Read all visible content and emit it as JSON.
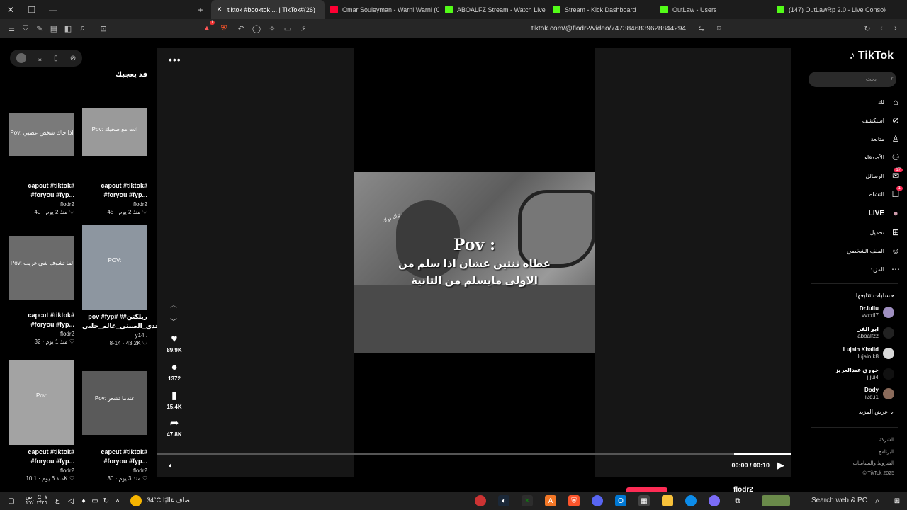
{
  "browser": {
    "tabs": [
      {
        "title": "tiktok #booktok ... | TikTok#(26)",
        "active": true,
        "favicon_color": "#ffffff"
      },
      {
        "title": "Omar Souleyman - Warni Warni (Offi",
        "active": false,
        "favicon_color": "#ff0033"
      },
      {
        "title": "ABOALFZ Stream - Watch Live on Kic",
        "active": false,
        "favicon_color": "#53fc18"
      },
      {
        "title": "Stream - Kick Dashboard",
        "active": false,
        "favicon_color": "#53fc18"
      },
      {
        "title": "OutLaw - Users",
        "active": false,
        "favicon_color": "#53fc18"
      },
      {
        "title": "(147) OutLawRp 2.0 - Live Console",
        "active": false,
        "favicon_color": "#53fc18"
      }
    ],
    "url": "tiktok.com/@flodr2/video/7473846839628844294",
    "notification_badge": "1"
  },
  "left_panel": {
    "heading": "قد يعجبك",
    "cards": [
      {
        "title": "capcut #tiktok# #foryou #fyp...",
        "user": "flodr2",
        "likes": "40",
        "age": "منذ 2 يوم",
        "pov": "Pov: اذا جاك شخص عصبي"
      },
      {
        "title": "capcut #tiktok# #foryou #fyp...",
        "user": "flodr2",
        "likes": "45",
        "age": "منذ 2 يوم",
        "pov": "Pov: انت مع صحبك"
      },
      {
        "title": "capcut #tiktok# #foryou #fyp...",
        "user": "flodr2",
        "likes": "32",
        "age": "منذ 1 يوم",
        "pov": "Pov: لما تشوف شي غريب"
      },
      {
        "title": "pov #fyp# #ريلكتن# التحدي_الصيني_عالم_حلبي...",
        "user": "y14..",
        "likes": "43.2K",
        "age": "8-14",
        "pov": "POV:"
      },
      {
        "title": "capcut #tiktok# #foryou #fyp...",
        "user": "flodr2",
        "likes": "10.1K",
        "age": "منذ 6 يوم",
        "pov": "Pov:"
      },
      {
        "title": "capcut #tiktok# #foryou #fyp...",
        "user": "flodr2",
        "likes": "30",
        "age": "منذ 3 يوم",
        "pov": "Pov: عندما تشعر"
      }
    ]
  },
  "video": {
    "pov_title": "Pov :",
    "caption_line1": "عطاه ثنتين عشان اذا سلم من",
    "caption_line2": "الاولى مايسلم من الثانية",
    "watermark": "تيك توك",
    "likes": "89.9K",
    "comments": "1372",
    "saves": "15.4K",
    "shares": "47.8K",
    "time": "00:00 / 00:10",
    "progress": 0.91,
    "author": "flodr2"
  },
  "right_sidebar": {
    "logo": "TikTok",
    "search_placeholder": "بحث",
    "nav": [
      {
        "label": "لك",
        "icon": "⌂"
      },
      {
        "label": "استكشف",
        "icon": "⊘"
      },
      {
        "label": "متابعة",
        "icon": "♙"
      },
      {
        "label": "الأصدقاء",
        "icon": "⚇"
      },
      {
        "label": "الرسائل",
        "icon": "✉",
        "badge": "17"
      },
      {
        "label": "النشاط",
        "icon": "☐",
        "badge": "1"
      },
      {
        "label": "LIVE",
        "icon": "●"
      },
      {
        "label": "تحميل",
        "icon": "⊞"
      },
      {
        "label": "الملف الشخصي",
        "icon": "☺"
      },
      {
        "label": "المزيد",
        "icon": "⋯"
      }
    ],
    "following_title": "حسابات تتابعها",
    "accounts": [
      {
        "name": "Dr.lullu",
        "handle": "vvxxil7",
        "avatar": "#9f8fc0"
      },
      {
        "name": "ابو الفز",
        "handle": "aboalfzz",
        "avatar": "#222222"
      },
      {
        "name": "Lujain Khalid",
        "handle": "lujain.k8",
        "avatar": "#d8d8d8"
      },
      {
        "name": "خوري عبدالعزيز",
        "handle": "j.jui4",
        "avatar": "#111111"
      },
      {
        "name": "Dody",
        "handle": "i2d.i1",
        "avatar": "#8a6a5a"
      }
    ],
    "show_more": "عرض المزيد",
    "footer": [
      "الشركة",
      "البرنامج",
      "الشروط والسياسات",
      "© TikTok 2025"
    ]
  },
  "taskbar": {
    "weather_temp": "34°C",
    "weather_text": "صاف غالبًا",
    "clock_time": "٠٤:٠٧ ص",
    "clock_date": "٢٧/٠٣/٢٥",
    "lang": "ع",
    "search": "Search web & PC"
  }
}
